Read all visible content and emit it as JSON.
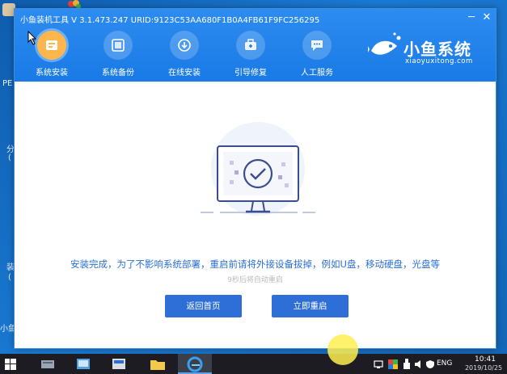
{
  "app": {
    "title": "小鱼装机工具 V 3.1.473.247 URID:9123C53AA680F1B0A4FB61F9FC256295",
    "nav": [
      {
        "label": "系统安装",
        "icon": "install-icon",
        "active": true
      },
      {
        "label": "系统备份",
        "icon": "backup-icon",
        "active": false
      },
      {
        "label": "在线安装",
        "icon": "download-icon",
        "active": false
      },
      {
        "label": "引导修复",
        "icon": "repair-icon",
        "active": false
      },
      {
        "label": "人工服务",
        "icon": "chat-icon",
        "active": false
      }
    ],
    "logo": {
      "name": "小鱼系统",
      "url": "xiaoyuxitong.com"
    }
  },
  "main": {
    "message": "安装完成，为了不影响系统部署，重启前请将外接设备拔掉，例如U盘，移动硬盘，光盘等",
    "countdown": "9秒后将自动重启",
    "buttons": {
      "home": "返回首页",
      "restart": "立即重启"
    }
  },
  "taskbar": {
    "lang": "ENG",
    "time": "10:41",
    "date": "2019/10/25"
  },
  "desktop_text": {
    "pe": "PE",
    "a": "分",
    "b": "(",
    "c": "装",
    "d": "(",
    "e": "小鱼"
  },
  "colors": {
    "header": "#1a7ae6",
    "accent": "#2d6fd6",
    "active_nav": "#ffb74d"
  }
}
